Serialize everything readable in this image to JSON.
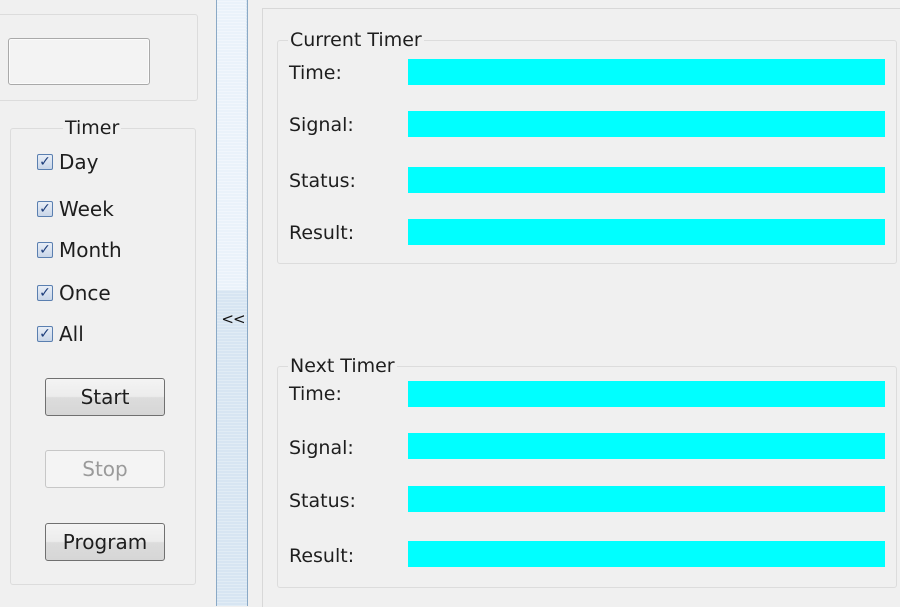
{
  "left_panel": {
    "timer_group": {
      "title": "Timer",
      "checkboxes": [
        {
          "label": "Day",
          "checked": true,
          "check_glyph": "✓"
        },
        {
          "label": "Week",
          "checked": true,
          "check_glyph": "✓"
        },
        {
          "label": "Month",
          "checked": true,
          "check_glyph": "✓"
        },
        {
          "label": "Once",
          "checked": true,
          "check_glyph": "✓"
        },
        {
          "label": "All",
          "checked": true,
          "check_glyph": "✓"
        }
      ]
    },
    "buttons": {
      "start": "Start",
      "stop": "Stop",
      "program": "Program"
    }
  },
  "splitter": {
    "toggle_label": "<<"
  },
  "current_timer": {
    "title": "Current Timer",
    "labels": {
      "time": "Time:",
      "signal": "Signal:",
      "status": "Status:",
      "result": "Result:"
    }
  },
  "next_timer": {
    "title": "Next Timer",
    "labels": {
      "time": "Time:",
      "signal": "Signal:",
      "status": "Status:",
      "result": "Result:"
    }
  },
  "colors": {
    "value_bar": "#00ffff",
    "background": "#f0f0f0",
    "splitter": "#d7e5f2"
  }
}
